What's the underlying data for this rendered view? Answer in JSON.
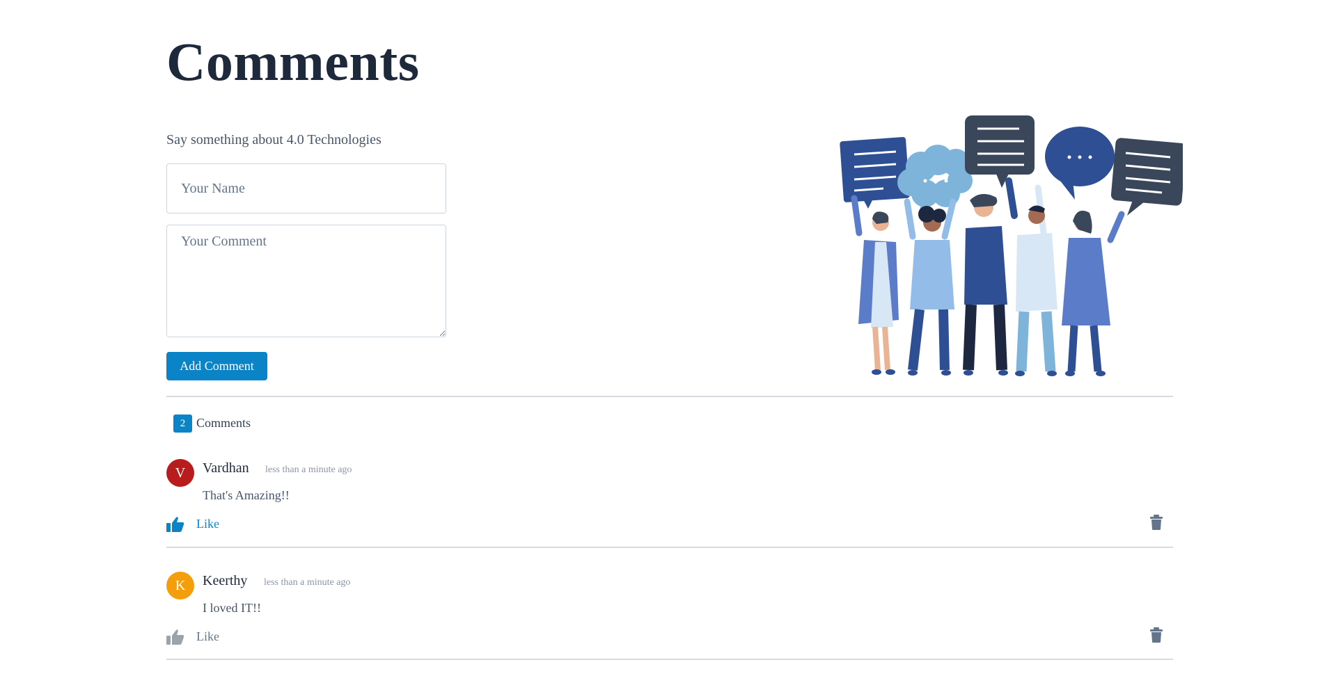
{
  "title": "Comments",
  "form": {
    "prompt": "Say something about 4.0 Technologies",
    "name_placeholder": "Your Name",
    "comment_placeholder": "Your Comment",
    "submit_label": "Add Comment"
  },
  "comments_count": "2",
  "comments_label": "Comments",
  "comments": [
    {
      "initial": "V",
      "author": "Vardhan",
      "time": "less than a minute ago",
      "text": "That's Amazing!!",
      "like_label": "Like",
      "liked": true,
      "avatar_color": "#b91c1c"
    },
    {
      "initial": "K",
      "author": "Keerthy",
      "time": "less than a minute ago",
      "text": "I loved IT!!",
      "like_label": "Like",
      "liked": false,
      "avatar_color": "#f59e0b"
    }
  ],
  "colors": {
    "accent": "#0b84c7",
    "liked": "#0b84c7",
    "unliked_icon": "#9ca3af",
    "unliked_text": "#64748b",
    "delete": "#64748b"
  },
  "icons": [
    "thumbs-up-icon",
    "trash-icon"
  ]
}
